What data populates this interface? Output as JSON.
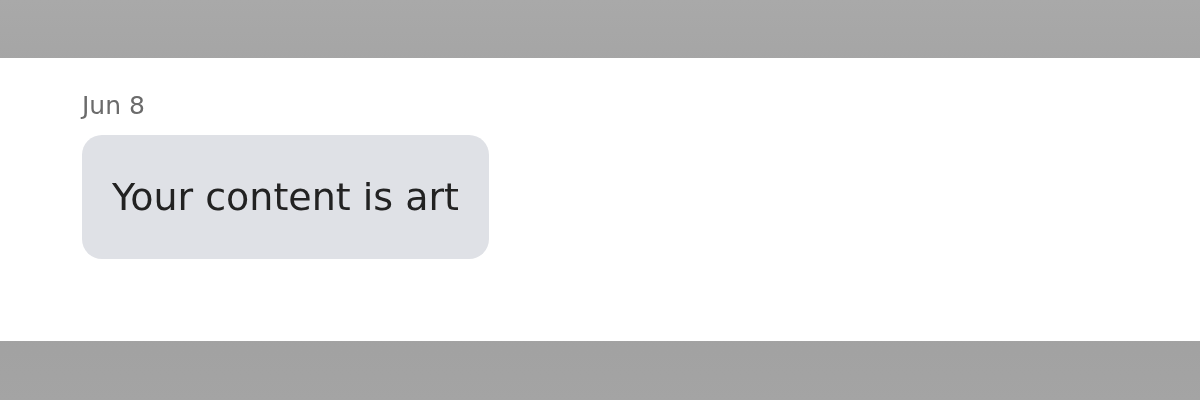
{
  "messages": [
    {
      "date": "Jun 8",
      "text": "Your content is art"
    }
  ]
}
